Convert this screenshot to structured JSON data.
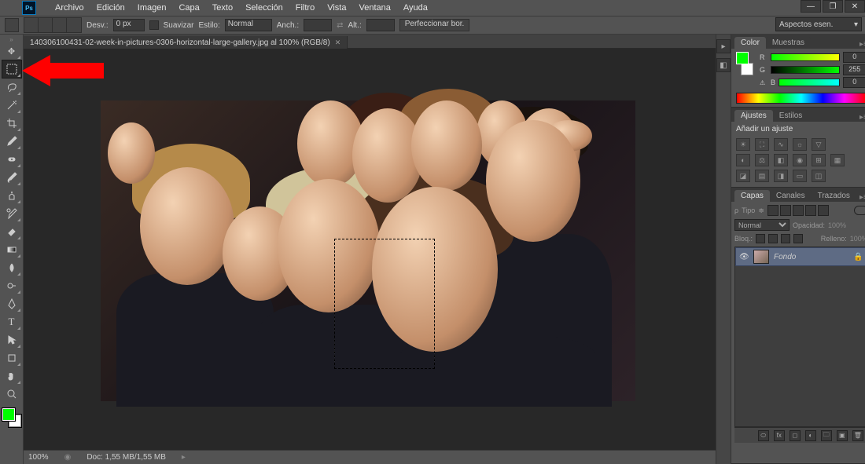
{
  "app": {
    "logo": "Ps"
  },
  "menu": [
    "Archivo",
    "Edición",
    "Imagen",
    "Capa",
    "Texto",
    "Selección",
    "Filtro",
    "Vista",
    "Ventana",
    "Ayuda"
  ],
  "options": {
    "desv_label": "Desv.:",
    "desv_value": "0 px",
    "suavizar": "Suavizar",
    "estilo_label": "Estilo:",
    "estilo_value": "Normal",
    "anch_label": "Anch.:",
    "alt_label": "Alt.:",
    "perfeccionar": "Perfeccionar bor."
  },
  "workspace_selector": "Aspectos esen.",
  "doc_tab": {
    "title": "140306100431-02-week-in-pictures-0306-horizontal-large-gallery.jpg al 100% (RGB/8)"
  },
  "statusbar": {
    "zoom": "100%",
    "docsize": "Doc: 1,55 MB/1,55 MB"
  },
  "color_panel": {
    "tabs": [
      "Color",
      "Muestras"
    ],
    "r_label": "R",
    "r_value": "0",
    "g_label": "G",
    "g_value": "255",
    "b_label": "B",
    "b_value": "0"
  },
  "adjustments_panel": {
    "tabs": [
      "Ajustes",
      "Estilos"
    ],
    "hint": "Añadir un ajuste"
  },
  "layers_panel": {
    "tabs": [
      "Capas",
      "Canales",
      "Trazados"
    ],
    "kind_label": "Tipo",
    "blend_mode": "Normal",
    "opacity_label": "Opacidad:",
    "opacity_value": "100%",
    "lock_label": "Bloq.:",
    "fill_label": "Relleno:",
    "fill_value": "100%",
    "layer_name": "Fondo"
  },
  "tools": [
    "move",
    "marquee",
    "lasso",
    "wand",
    "crop",
    "eyedropper",
    "heal",
    "brush",
    "clone",
    "history-brush",
    "eraser",
    "gradient",
    "blur",
    "dodge",
    "pen",
    "type",
    "path-select",
    "shape",
    "hand",
    "zoom"
  ]
}
